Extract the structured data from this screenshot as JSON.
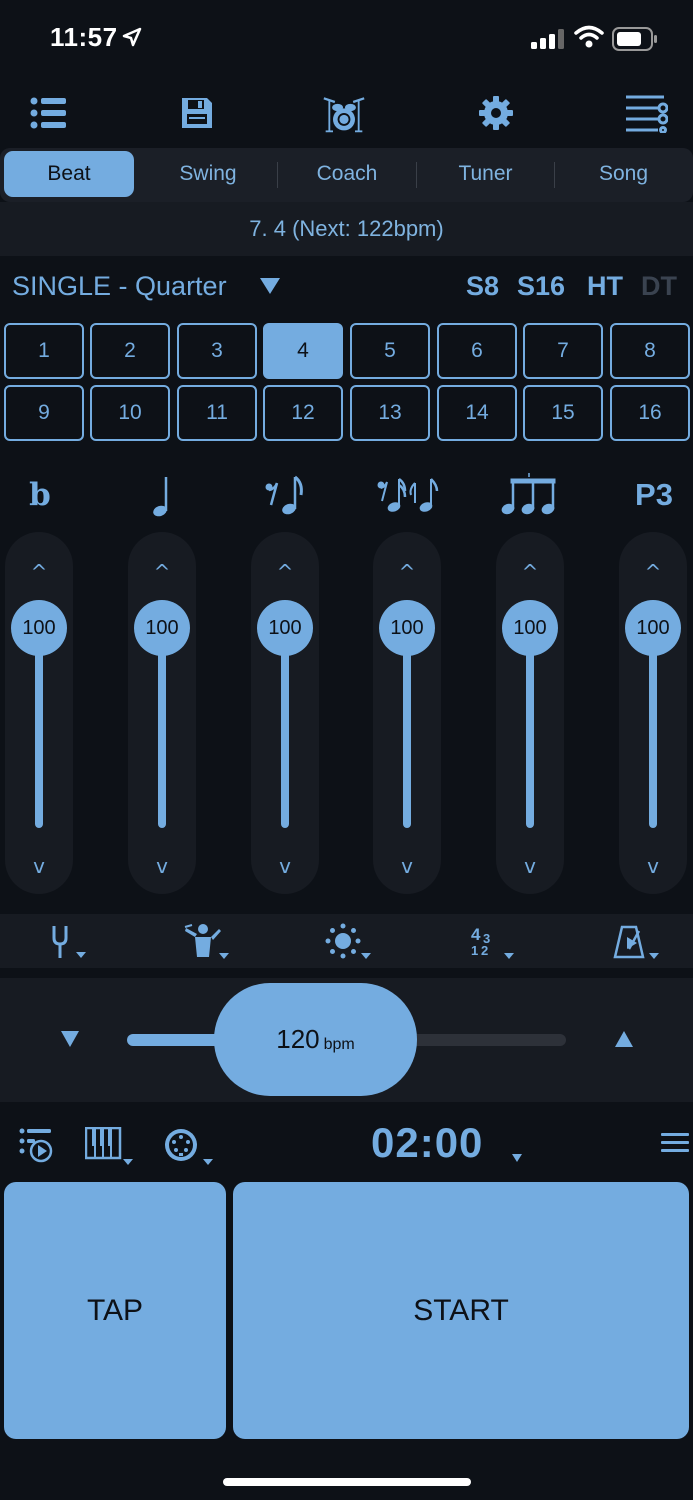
{
  "status_bar": {
    "time": "11:57"
  },
  "tabs": [
    {
      "label": "Beat",
      "active": true
    },
    {
      "label": "Swing",
      "active": false
    },
    {
      "label": "Coach",
      "active": false
    },
    {
      "label": "Tuner",
      "active": false
    },
    {
      "label": "Song",
      "active": false
    }
  ],
  "info_text": "7. 4 (Next: 122bpm)",
  "mode": {
    "label": "SINGLE - Quarter",
    "options": [
      "S8",
      "S16",
      "HT",
      "DT"
    ],
    "disabled_option": "DT"
  },
  "beats": {
    "values": [
      "1",
      "2",
      "3",
      "4",
      "5",
      "6",
      "7",
      "8",
      "9",
      "10",
      "11",
      "12",
      "13",
      "14",
      "15",
      "16"
    ],
    "selected": "4"
  },
  "subdivisions": {
    "labels": [
      "b",
      "P3"
    ],
    "icons": [
      "flat-icon",
      "quarter-note-icon",
      "eighth-rest-note-icon",
      "sixteenth-notes-icon",
      "triplet-notes-icon",
      "p3-label"
    ]
  },
  "volumes": [
    "100",
    "100",
    "100",
    "100",
    "100",
    "100"
  ],
  "tools": [
    "tuning-fork-icon",
    "conductor-icon",
    "brightness-icon",
    "time-signature-icon",
    "metronome-play-icon"
  ],
  "tempo": {
    "value": "120",
    "unit": "bpm"
  },
  "timer": "02:00",
  "buttons": {
    "tap": "TAP",
    "start": "START"
  },
  "colors": {
    "accent": "#74ace0",
    "background": "#0d1117",
    "panel": "#171b22"
  }
}
